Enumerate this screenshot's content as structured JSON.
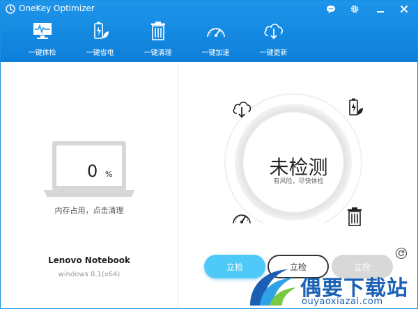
{
  "window": {
    "title": "OneKey Optimizer",
    "controls": [
      "chat-icon",
      "gear-icon",
      "minimize-icon",
      "close-icon"
    ]
  },
  "nav": {
    "items": [
      {
        "label": "一键体检",
        "icon": "monitor-pulse-icon"
      },
      {
        "label": "一键省电",
        "icon": "battery-leaf-icon"
      },
      {
        "label": "一键清理",
        "icon": "trash-icon"
      },
      {
        "label": "一键加速",
        "icon": "speedometer-icon"
      },
      {
        "label": "一键更新",
        "icon": "cloud-download-icon"
      }
    ]
  },
  "left": {
    "memory_value": "0",
    "memory_unit": "%",
    "memory_caption": "内存占用，点击清理",
    "device_name": "Lenovo Notebook",
    "os": "windows 8.1(x64)"
  },
  "right": {
    "status_main": "未检测",
    "status_sub": "有风险，尽快体检",
    "buttons": {
      "primary": "立检",
      "outline": "立检",
      "disabled": "立检"
    }
  },
  "watermark": {
    "text": "偶要下载站",
    "url": "ouyaoxiazai.com"
  },
  "colors": {
    "header": "#1d95ea",
    "primary_button": "#4fc9f7",
    "watermark": "#1a5fb4"
  }
}
